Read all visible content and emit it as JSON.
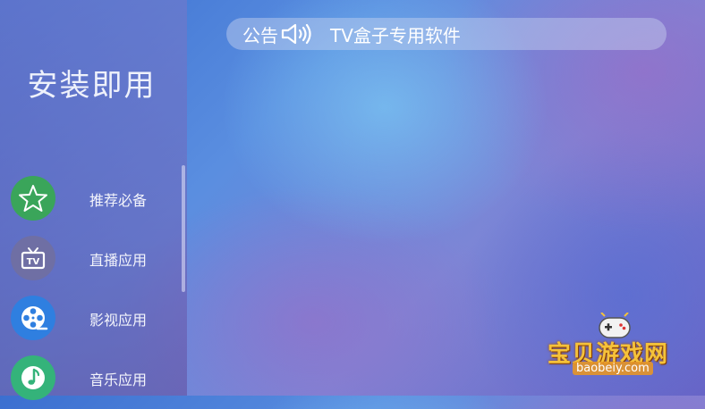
{
  "sidebar": {
    "title": "安装即用",
    "items": [
      {
        "label": "推荐必备",
        "icon": "star-icon",
        "color": "#3aa55a"
      },
      {
        "label": "直播应用",
        "icon": "tv-icon",
        "color": "#6f6fa4"
      },
      {
        "label": "影视应用",
        "icon": "film-reel-icon",
        "color": "#2f7fe0"
      },
      {
        "label": "音乐应用",
        "icon": "music-note-icon",
        "color": "#34b37a"
      }
    ]
  },
  "notice": {
    "label": "公告",
    "icon": "speaker-icon",
    "text": "TV盒子专用软件"
  },
  "watermark": {
    "title": "宝贝游戏网",
    "url": "baobeiy.com",
    "icon": "gamepad-icon"
  }
}
